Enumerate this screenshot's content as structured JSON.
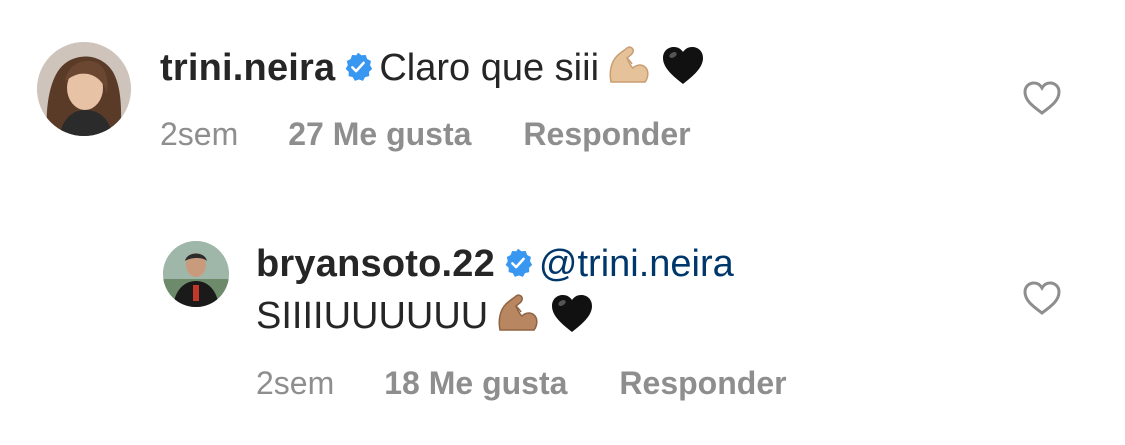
{
  "comments": [
    {
      "username": "trini.neira",
      "verified": true,
      "text": "Claro que siii",
      "emojis": [
        "flexed-biceps-icon",
        "black-heart-icon"
      ],
      "time": "2sem",
      "likes": "27 Me gusta",
      "reply_label": "Responder"
    },
    {
      "username": "bryansoto.22",
      "verified": true,
      "mention": "@trini.neira",
      "text": "SIIIIUUUUUU",
      "emojis": [
        "flexed-biceps-icon",
        "black-heart-icon"
      ],
      "time": "2sem",
      "likes": "18 Me gusta",
      "reply_label": "Responder"
    }
  ],
  "colors": {
    "text": "#262626",
    "meta": "#8e8e8e",
    "mention": "#00376b",
    "verified_badge": "#3897f0"
  }
}
